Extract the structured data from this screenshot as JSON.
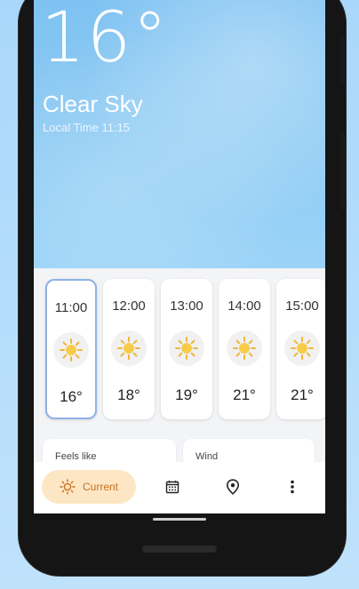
{
  "current": {
    "temperature": "16°",
    "condition": "Clear Sky",
    "local_time": "Local Time 11:15"
  },
  "hourly": [
    {
      "time": "11:00",
      "icon": "sun-icon",
      "temp": "16°",
      "selected": true
    },
    {
      "time": "12:00",
      "icon": "sun-icon",
      "temp": "18°",
      "selected": false
    },
    {
      "time": "13:00",
      "icon": "sun-icon",
      "temp": "19°",
      "selected": false
    },
    {
      "time": "14:00",
      "icon": "sun-icon",
      "temp": "21°",
      "selected": false
    },
    {
      "time": "15:00",
      "icon": "sun-icon",
      "temp": "21°",
      "selected": false
    }
  ],
  "details": {
    "feels_like_label": "Feels like",
    "wind_label": "Wind"
  },
  "nav": {
    "current_label": "Current",
    "items": [
      "sun-icon",
      "calendar-icon",
      "location-pin-icon",
      "more-vertical-icon"
    ]
  },
  "colors": {
    "accent": "#c7701a",
    "nav_active_bg": "#fde6c4",
    "selected_border": "#8fb2e8",
    "sun": "#f5c33b"
  }
}
